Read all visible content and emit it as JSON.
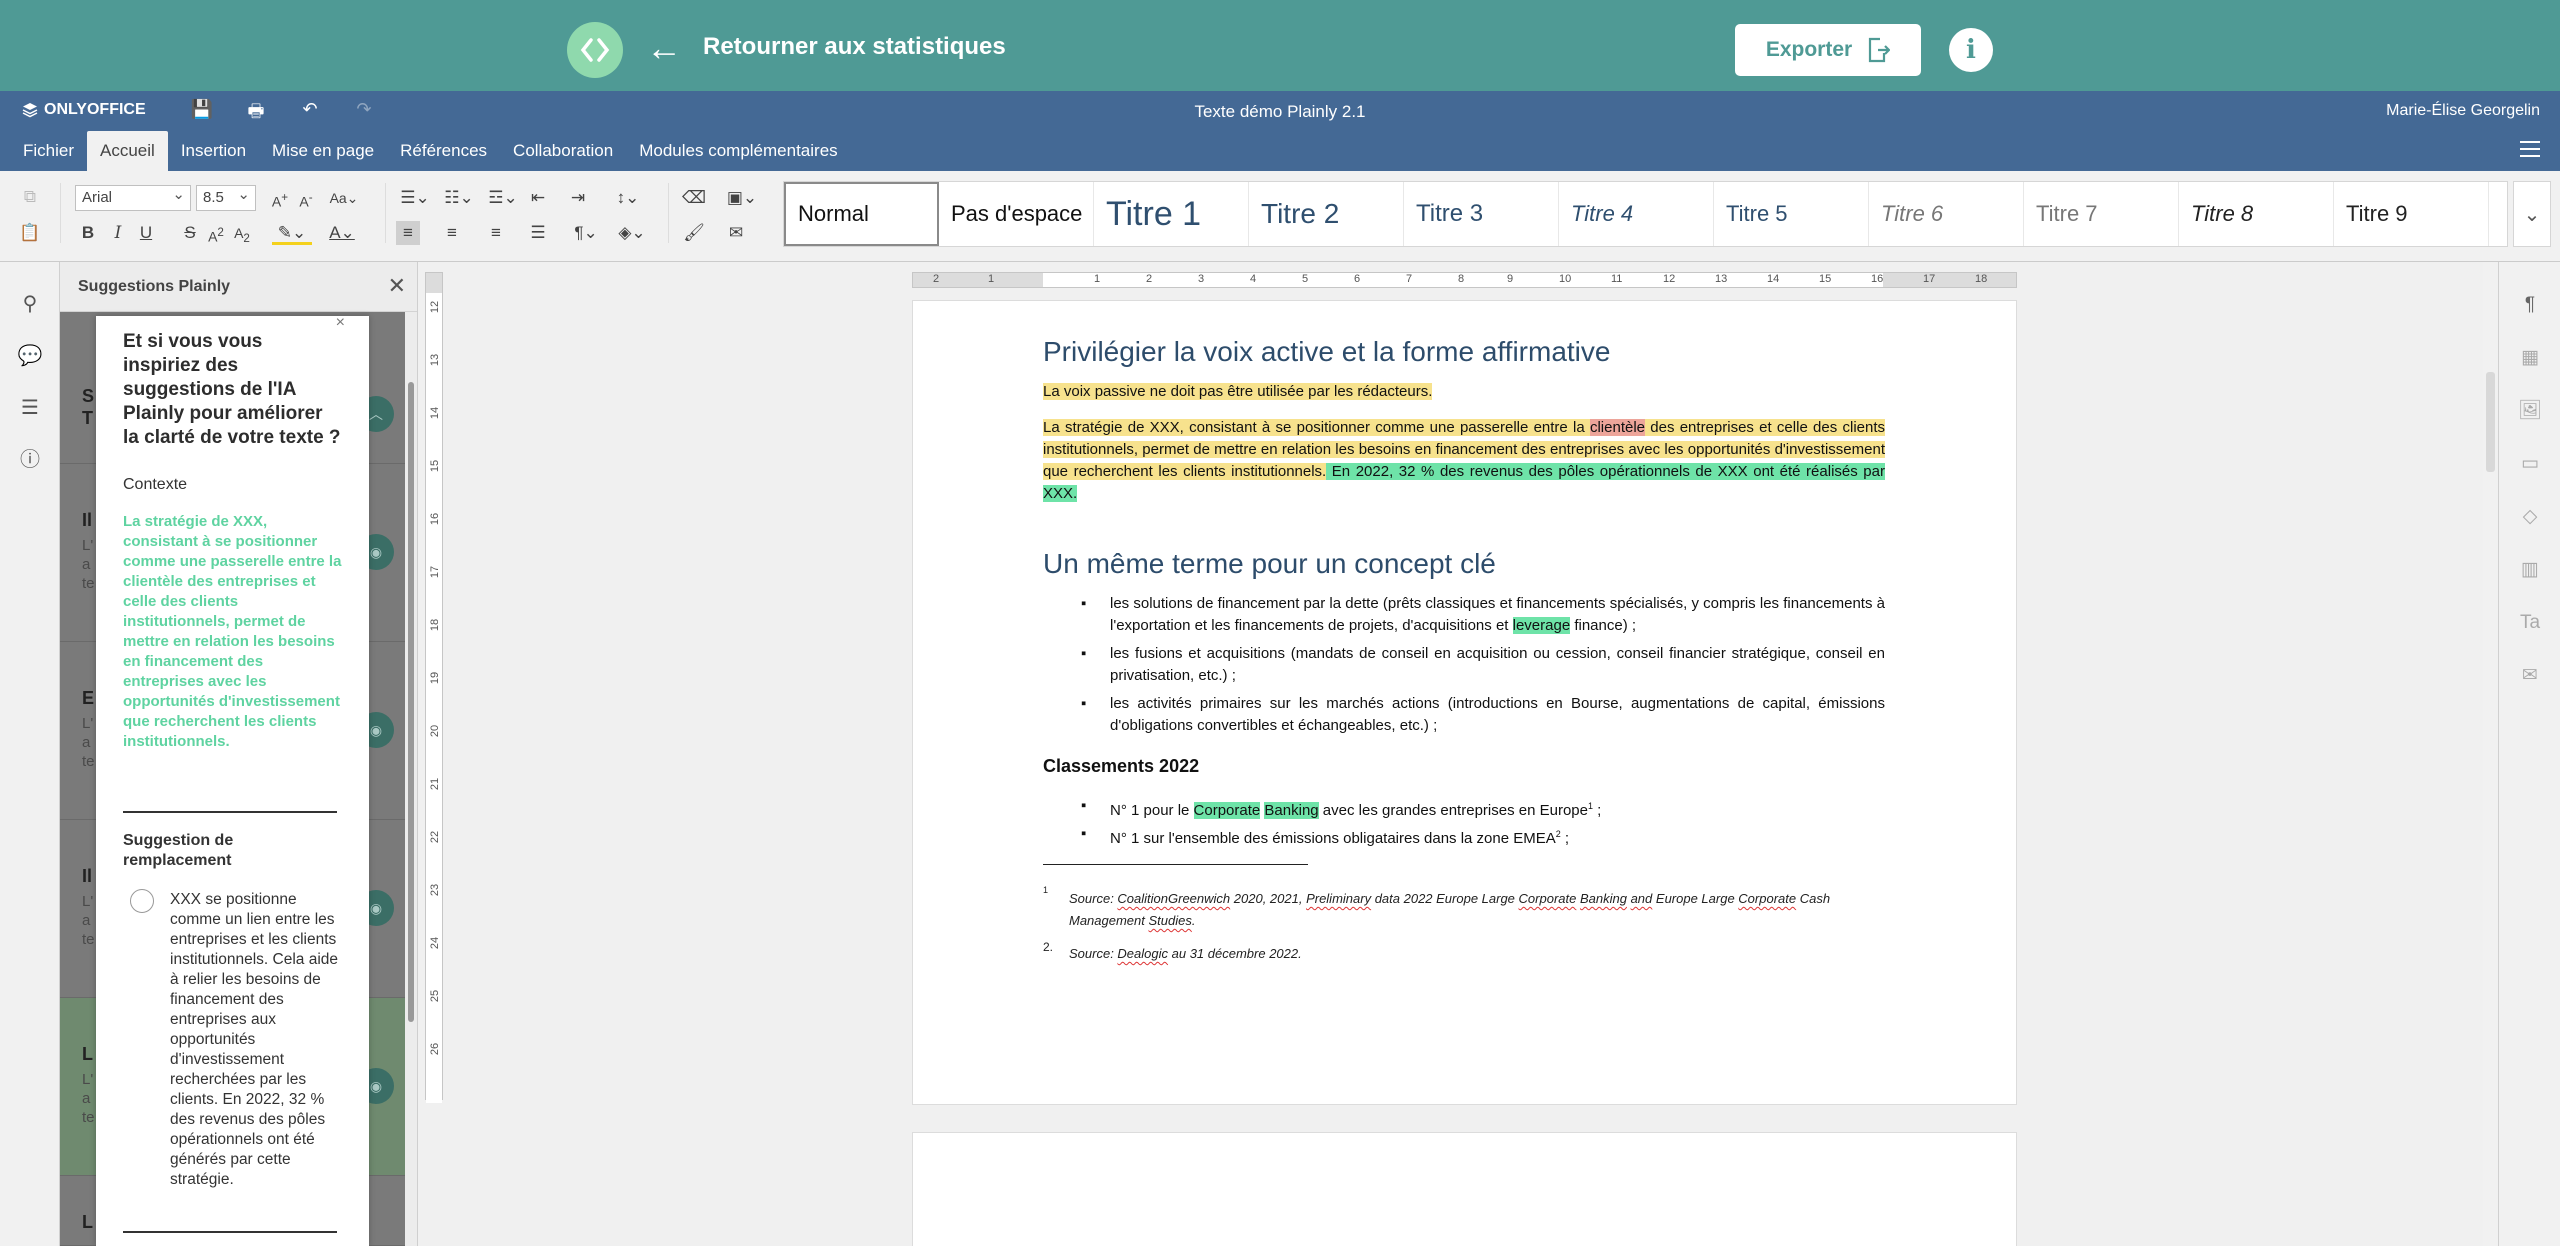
{
  "plainly": {
    "back_label": "Retourner aux statistiques",
    "export_label": "Exporter",
    "info_label": "i"
  },
  "app": {
    "brand": "ONLYOFFICE",
    "doc_title": "Texte démo Plainly 2.1",
    "user": "Marie-Élise Georgelin"
  },
  "tabs": [
    "Fichier",
    "Accueil",
    "Insertion",
    "Mise en page",
    "Références",
    "Collaboration",
    "Modules complémentaires"
  ],
  "toolbar": {
    "font_name": "Arial",
    "font_size": "8.5",
    "styles": [
      "Normal",
      "Pas d'espace",
      "Titre 1",
      "Titre 2",
      "Titre 3",
      "Titre 4",
      "Titre 5",
      "Titre 6",
      "Titre 7",
      "Titre 8",
      "Titre 9"
    ]
  },
  "panel": {
    "title": "Suggestions Plainly",
    "items": [
      {
        "lt": "S",
        "lt2": "T"
      },
      {
        "lt": "Il",
        "st": [
          "L'",
          "a",
          "te"
        ]
      },
      {
        "lt": "E",
        "st": [
          "L'",
          "a",
          "te"
        ]
      },
      {
        "lt": "Il",
        "st": [
          "L'",
          "a",
          "te"
        ]
      },
      {
        "lt": "L",
        "st": [
          "L'",
          "a",
          "te"
        ]
      },
      {
        "lt": "L"
      }
    ],
    "popup": {
      "question": "Et si vous vous inspiriez des suggestions de l'IA Plainly pour améliorer la clarté de votre texte ?",
      "context_label": "Contexte",
      "context_text": "La stratégie de XXX, consistant à se positionner comme une passerelle entre la clientèle des entreprises et celle des clients institutionnels, permet de mettre en relation les besoins en financement des entreprises avec les opportunités d'investissement que recherchent les clients institutionnels.",
      "replacement_label": "Suggestion de remplacement",
      "replacement_text": "XXX se positionne comme un lien entre les entreprises et les clients institutionnels. Cela aide à relier les besoins de financement des entreprises aux opportunités d'investissement recherchées par les clients. En 2022, 32 % des revenus des pôles opérationnels ont été générés par cette stratégie."
    }
  },
  "document": {
    "h1a": "Privilégier la voix active et la forme affirmative",
    "p1": "La voix passive ne doit pas être utilisée par les rédacteurs.",
    "p2_a": "La stratégie de XXX, consistant à se positionner comme une passerelle entre la ",
    "p2_red": "clientèle",
    "p2_b": " des entreprises et celle des clients institutionnels, permet de mettre en relation les besoins en financement des entreprises avec les opportunités d'investissement que recherchent les clients institutionnels.",
    "p2_green": " En 2022, 32 % des revenus des pôles opérationnels de XXX ont été réalisés par XXX.",
    "h1b": "Un même terme pour un concept clé",
    "b1_a": "les solutions de financement par la dette (prêts classiques et financements spécialisés, y compris les financements à l'exportation et les financements de projets, d'acquisitions et ",
    "b1_hl": "leverage",
    "b1_b": " finance) ;",
    "b2": "les fusions et acquisitions (mandats de conseil en acquisition ou cession, conseil financier stratégique, conseil en privatisation, etc.) ;",
    "b3": "les activités primaires sur les marchés actions (introductions en Bourse, augmentations de capital, émissions d'obligations convertibles et échangeables, etc.) ;",
    "h3": "Classements 2022",
    "r1_a": "N° 1 pour le ",
    "r1_hl1": "Corporate",
    "r1_hl2": "Banking",
    "r1_b": " avec les grandes entreprises en Europe",
    "r1_sup": "1",
    "r1_c": " ;",
    "r2_a": "N° 1 sur l'ensemble des émissions obligataires dans la zone EMEA",
    "r2_sup": "2",
    "r2_c": " ;",
    "fn1_num": "1",
    "fn1_a": "Source: ",
    "fn1_u1": "CoalitionGreenwich",
    "fn1_b": " 2020, 2021, ",
    "fn1_u2": "Preliminary",
    "fn1_c": " data 2022 Europe Large ",
    "fn1_u3": "Corporate",
    "fn1_d": " ",
    "fn1_u4": "Banking",
    "fn1_e": " ",
    "fn1_u5": "and",
    "fn1_f": " Europe Large ",
    "fn1_u6": "Corporate",
    "fn1_g": " Cash",
    "fn1_line2_a": "Management ",
    "fn1_u7": "Studies",
    "fn1_line2_b": ".",
    "fn2_num": "2.",
    "fn2_a": "Source: ",
    "fn2_u1": "Dealogic",
    "fn2_b": " au 31 décembre 2022."
  },
  "hruler_ticks": [
    "2",
    "1",
    "1",
    "2",
    "3",
    "4",
    "5",
    "6",
    "7",
    "8",
    "9",
    "10",
    "11",
    "12",
    "13",
    "14",
    "15",
    "16",
    "17",
    "18"
  ],
  "vruler_ticks": [
    "12",
    "13",
    "14",
    "15",
    "16",
    "17",
    "18",
    "19",
    "20",
    "21",
    "22",
    "23",
    "24",
    "25",
    "26"
  ]
}
